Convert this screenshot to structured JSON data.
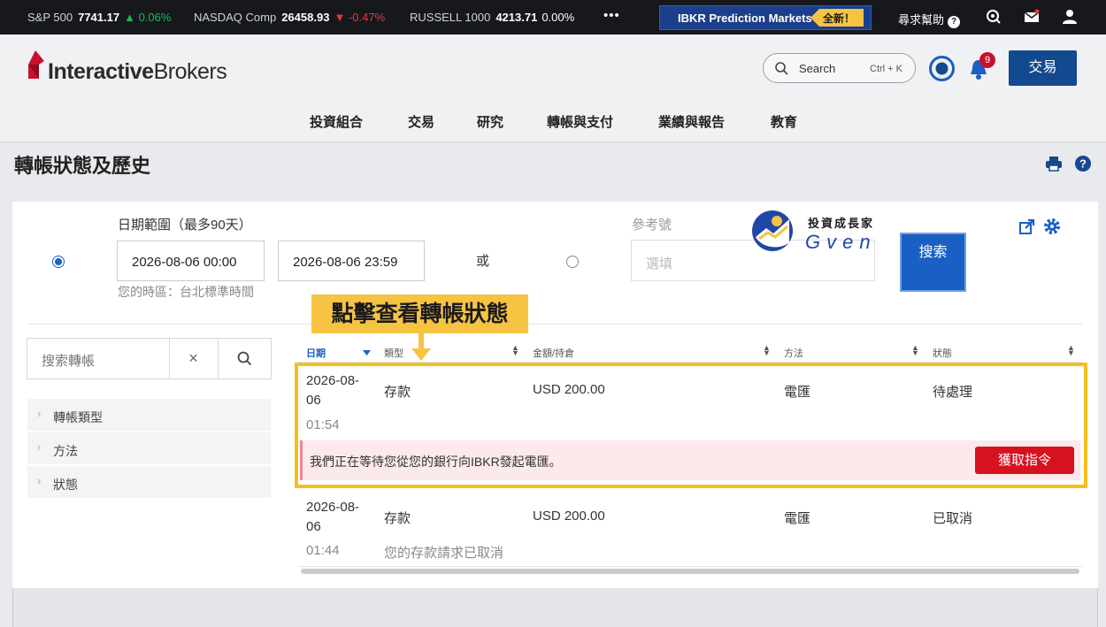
{
  "ticker": {
    "items": [
      {
        "name": "S&P 500",
        "value": "7741.17",
        "change": "0.06%",
        "dir": "up"
      },
      {
        "name": "NASDAQ Comp",
        "value": "26458.93",
        "change": "-0.47%",
        "dir": "down"
      },
      {
        "name": "RUSSELL 1000",
        "value": "4213.71",
        "change": "0.00%",
        "dir": "flat"
      }
    ],
    "more": "•••",
    "promo": {
      "label": "IBKR Prediction Markets",
      "badge": "全新！"
    },
    "help": "尋求幫助",
    "help_icon": "?"
  },
  "header": {
    "logo_bold": "Interactive",
    "logo_rest": "Brokers",
    "search_label": "Search",
    "search_shortcut": "Ctrl + K",
    "notification_count": "9",
    "trade_label": "交易",
    "nav": [
      "投資組合",
      "交易",
      "研究",
      "轉帳與支付",
      "業績與報告",
      "教育"
    ]
  },
  "page": {
    "title": "轉帳狀態及歷史"
  },
  "filter_form": {
    "date_range_label": "日期範圍（最多90天）",
    "date_from": "2026-08-06 00:00",
    "date_to": "2026-08-06 23:59",
    "timezone": "您的時區：台北標準時間",
    "or_label": "或",
    "ref_label": "參考號",
    "ref_placeholder": "選填",
    "search_button": "搜索"
  },
  "sidebar": {
    "search_placeholder": "搜索轉帳",
    "clear": "×",
    "filters": [
      "轉帳類型",
      "方法",
      "狀態"
    ]
  },
  "table": {
    "headers": [
      "日期",
      "類型",
      "金額/持倉",
      "方法",
      "狀態"
    ],
    "rows": [
      {
        "date": "2026-08-06",
        "time": "01:54",
        "type": "存款",
        "amount": "USD 200.00",
        "method": "電匯",
        "status": "待處理",
        "notice": "我們正在等待您從您的銀行向IBKR發起電匯。",
        "action": "獲取指令"
      },
      {
        "date": "2026-08-06",
        "time": "01:44",
        "type": "存款",
        "amount": "USD 200.00",
        "method": "電匯",
        "status": "已取消",
        "note": "您的存款請求已取消"
      }
    ]
  },
  "annotation": {
    "callout": "點擊查看轉帳狀態",
    "watermark_title": "投資成長家",
    "watermark_name": "Gven"
  },
  "colors": {
    "accent": "#1a5fc4",
    "highlight": "#f5bf1b",
    "danger": "#d6121f",
    "header_bg": "#16181c"
  }
}
